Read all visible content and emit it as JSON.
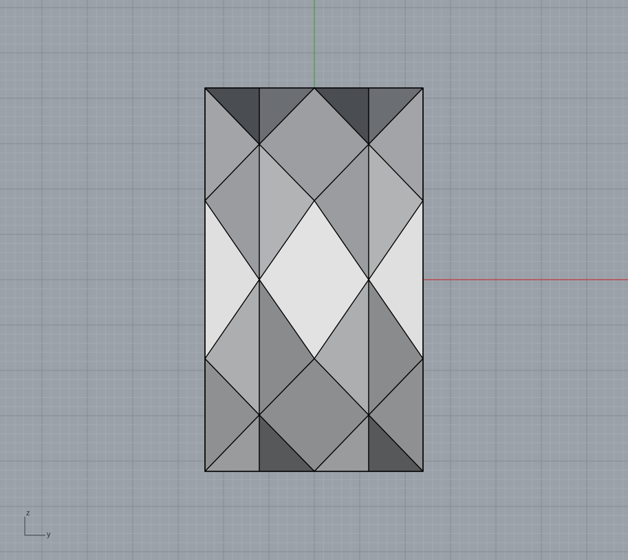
{
  "viewport": {
    "view": "Right",
    "background": "#9ba1a9",
    "grid_minor_color": "#a7adb4",
    "grid_major_color": "#868c94"
  },
  "axes": {
    "x_axis_color": "#c0393b",
    "y_axis_color": "#3aa53a",
    "widget": {
      "vertical_label": "z",
      "horizontal_label": "y"
    }
  },
  "model": {
    "name": "faceted-panel",
    "edge_color": "#000000"
  }
}
